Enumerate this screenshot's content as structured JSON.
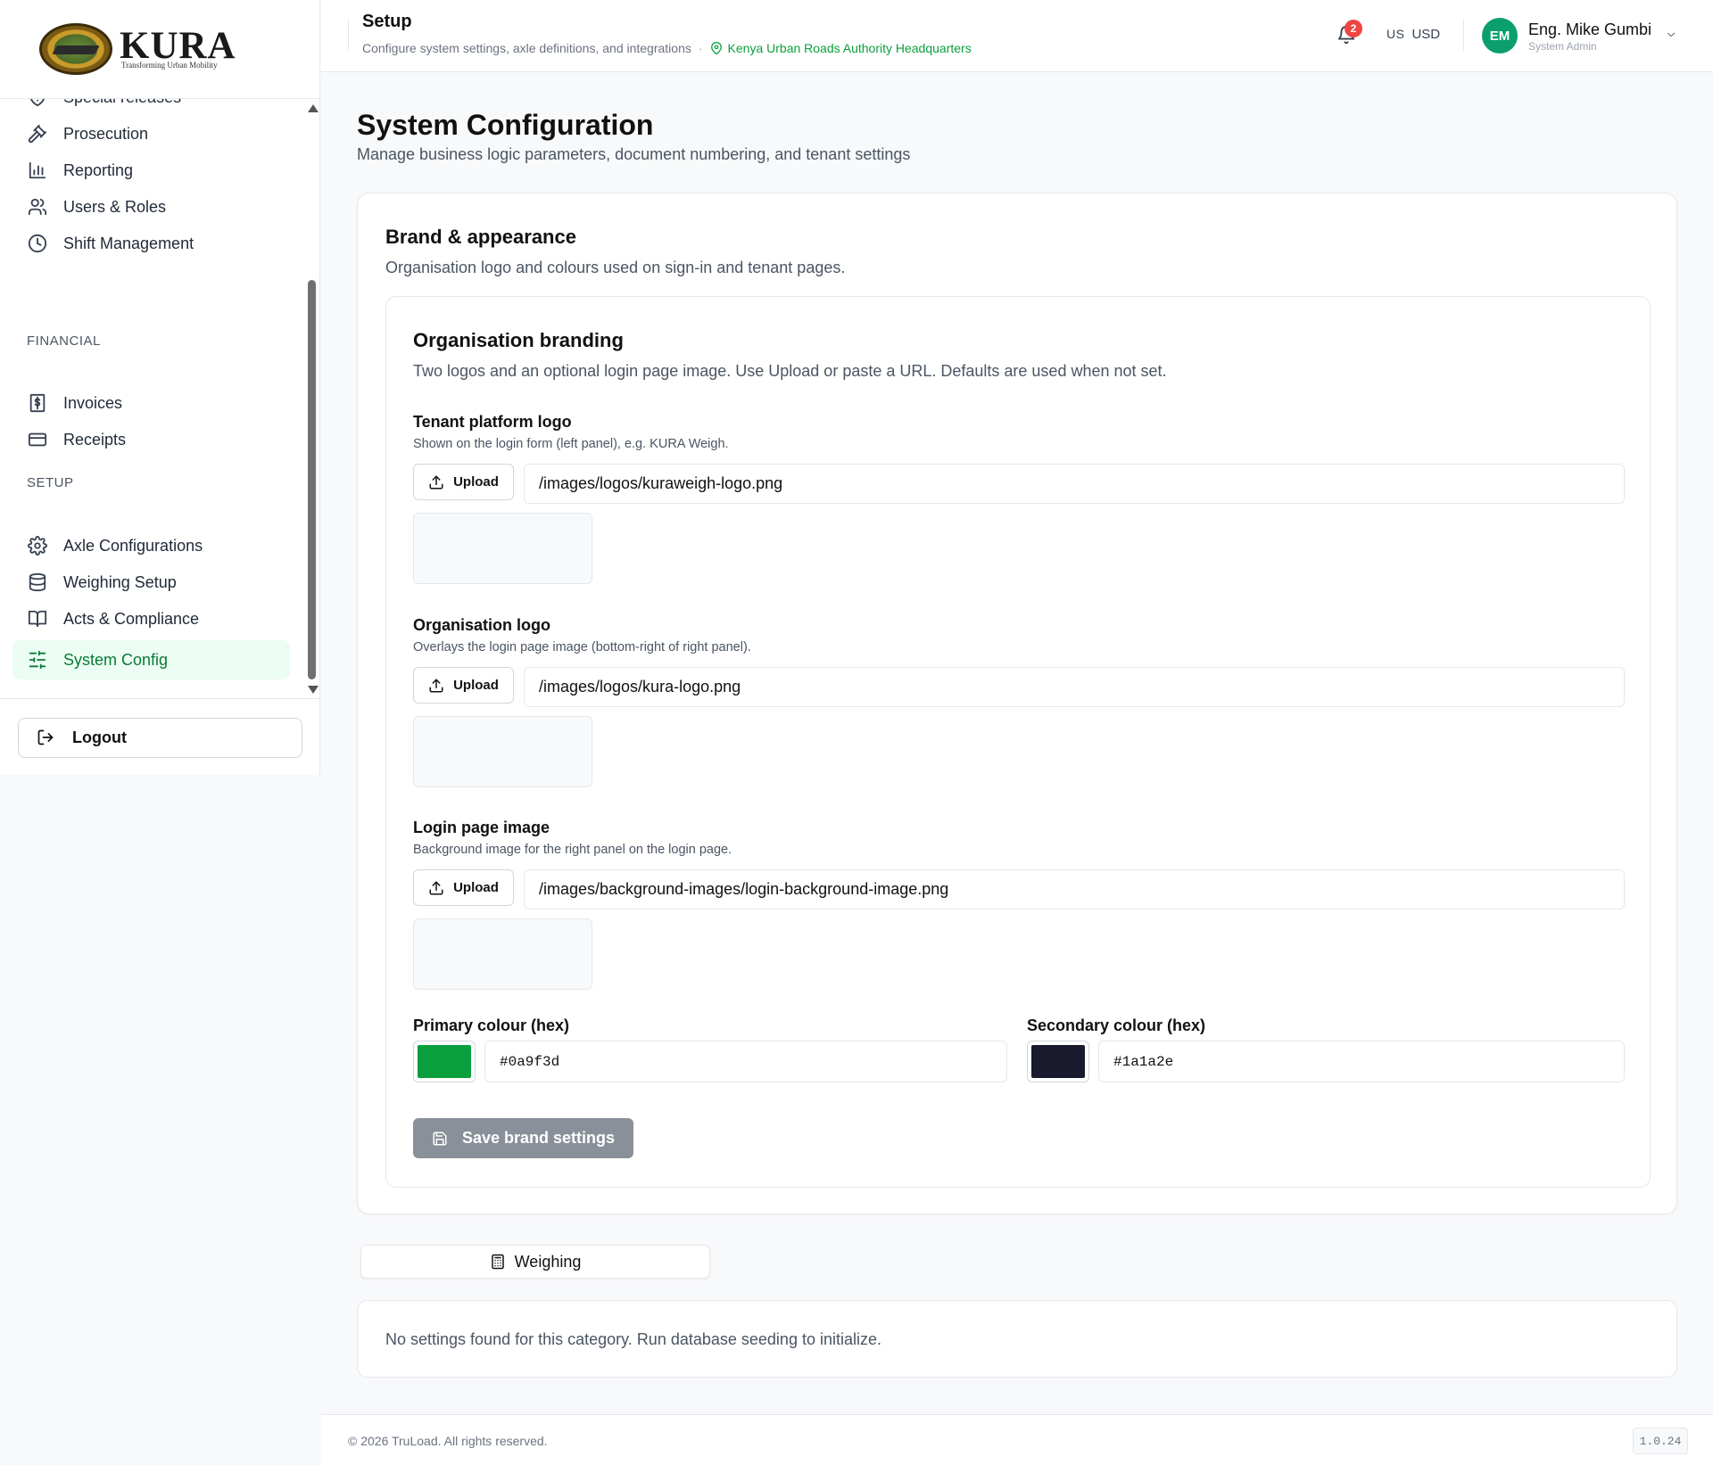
{
  "brand": {
    "name": "KURA",
    "tagline": "Transforming Urban Mobility"
  },
  "sidebar": {
    "items": [
      {
        "label": "Special releases",
        "icon": "shield-alert-icon"
      },
      {
        "label": "Prosecution",
        "icon": "gavel-icon"
      },
      {
        "label": "Reporting",
        "icon": "bar-chart-icon"
      },
      {
        "label": "Users & Roles",
        "icon": "users-icon"
      },
      {
        "label": "Shift Management",
        "icon": "clock-icon"
      }
    ],
    "financial_title": "FINANCIAL",
    "financial": [
      {
        "label": "Invoices",
        "icon": "invoice-icon"
      },
      {
        "label": "Receipts",
        "icon": "credit-card-icon"
      }
    ],
    "setup_title": "SETUP",
    "setup": [
      {
        "label": "Axle Configurations",
        "icon": "gear-icon"
      },
      {
        "label": "Weighing Setup",
        "icon": "database-icon"
      },
      {
        "label": "Acts & Compliance",
        "icon": "book-icon"
      },
      {
        "label": "System Config",
        "icon": "sliders-icon",
        "active": true
      }
    ],
    "logout_label": "Logout"
  },
  "topbar": {
    "title": "Setup",
    "subtitle": "Configure system settings, axle definitions, and integrations",
    "separator": "·",
    "location": "Kenya Urban Roads Authority Headquarters",
    "notifications_count": "2",
    "currency_flag": "US",
    "currency": "USD",
    "user_initials": "EM",
    "user_name": "Eng. Mike Gumbi",
    "user_role": "System Admin"
  },
  "page": {
    "title": "System Configuration",
    "subtitle": "Manage business logic parameters, document numbering, and tenant settings"
  },
  "brand_card": {
    "title": "Brand & appearance",
    "subtitle": "Organisation logo and colours used on sign-in and tenant pages.",
    "inner_title": "Organisation branding",
    "inner_subtitle": "Two logos and an optional login page image. Use Upload or paste a URL. Defaults are used when not set.",
    "upload_label": "Upload",
    "fields": [
      {
        "label": "Tenant platform logo",
        "help": "Shown on the login form (left panel), e.g. KURA Weigh.",
        "value": "/images/logos/kuraweigh-logo.png"
      },
      {
        "label": "Organisation logo",
        "help": "Overlays the login page image (bottom-right of right panel).",
        "value": "/images/logos/kura-logo.png"
      },
      {
        "label": "Login page image",
        "help": "Background image for the right panel on the login page.",
        "value": "/images/background-images/login-background-image.png"
      }
    ],
    "primary_label": "Primary colour (hex)",
    "primary_value": "#0a9f3d",
    "secondary_label": "Secondary colour (hex)",
    "secondary_value": "#1a1a2e",
    "save_label": "Save brand settings"
  },
  "tabs": {
    "weighing_label": "Weighing"
  },
  "empty": {
    "message": "No settings found for this category. Run database seeding to initialize."
  },
  "footer": {
    "copyright": "© 2026 TruLoad. All rights reserved.",
    "version": "1.0.24"
  },
  "colors": {
    "accent": "#0a9f3d",
    "accent_bg": "#ecfdf3",
    "badge": "#ef4444",
    "avatar": "#0a9f6d",
    "save_button": "#8a9099"
  }
}
